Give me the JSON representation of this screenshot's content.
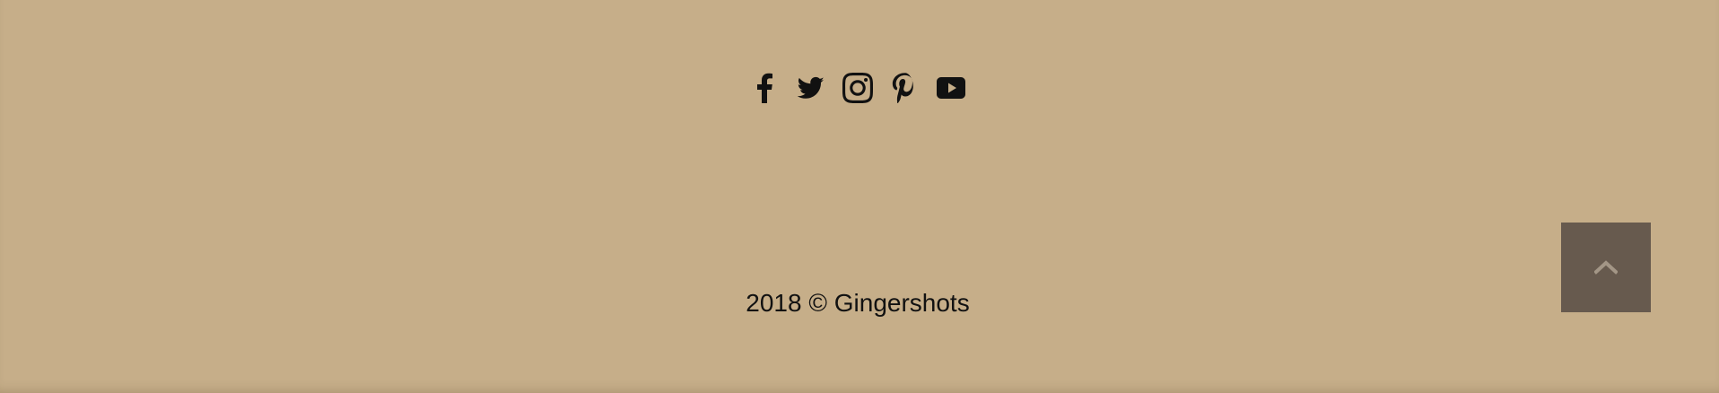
{
  "footer": {
    "social": [
      {
        "name": "Facebook",
        "icon": "facebook-icon"
      },
      {
        "name": "Twitter",
        "icon": "twitter-icon"
      },
      {
        "name": "Instagram",
        "icon": "instagram-icon"
      },
      {
        "name": "Pinterest",
        "icon": "pinterest-icon"
      },
      {
        "name": "YouTube",
        "icon": "youtube-icon"
      }
    ],
    "copyright": "2018 © Gingershots",
    "back_to_top_icon": "chevron-up-icon"
  },
  "colors": {
    "background": "#c6ae89",
    "icon": "#111111",
    "back_to_top_bg": "#675a4e",
    "back_to_top_icon": "#a39686"
  }
}
